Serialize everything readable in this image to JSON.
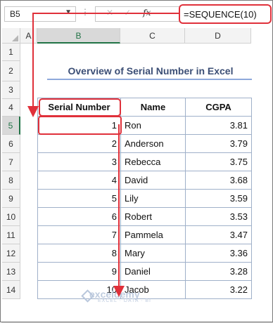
{
  "formula_bar": {
    "name_box": "B5",
    "name_caret": "▼",
    "separator": "⋮",
    "cancel_icon": "✕",
    "enter_icon": "✓",
    "fx_label": "fx",
    "formula": "=SEQUENCE(10)"
  },
  "columns": [
    "A",
    "B",
    "C",
    "D"
  ],
  "rows": [
    "1",
    "2",
    "3",
    "4",
    "5",
    "6",
    "7",
    "8",
    "9",
    "10",
    "11",
    "12",
    "13",
    "14"
  ],
  "sheet_title": "Overview of Serial Number in Excel",
  "table": {
    "headers": [
      "Serial Number",
      "Name",
      "CGPA"
    ],
    "rows": [
      {
        "serial": "1",
        "name": "Ron",
        "cgpa": "3.81"
      },
      {
        "serial": "2",
        "name": "Anderson",
        "cgpa": "3.79"
      },
      {
        "serial": "3",
        "name": "Rebecca",
        "cgpa": "3.75"
      },
      {
        "serial": "4",
        "name": "David",
        "cgpa": "3.68"
      },
      {
        "serial": "5",
        "name": "Lily",
        "cgpa": "3.59"
      },
      {
        "serial": "6",
        "name": "Robert",
        "cgpa": "3.53"
      },
      {
        "serial": "7",
        "name": "Pammela",
        "cgpa": "3.47"
      },
      {
        "serial": "8",
        "name": "Mary",
        "cgpa": "3.36"
      },
      {
        "serial": "9",
        "name": "Daniel",
        "cgpa": "3.28"
      },
      {
        "serial": "10",
        "name": "Jacob",
        "cgpa": "3.22"
      }
    ]
  },
  "watermark": {
    "brand": "exceldemy",
    "tagline": "EXCEL · DATA · BI"
  },
  "colors": {
    "highlight": "#e0303a",
    "title": "#3b4e75",
    "selection": "#217346"
  }
}
